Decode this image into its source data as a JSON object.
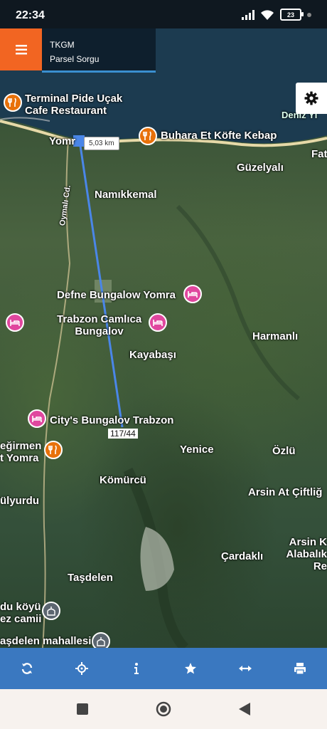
{
  "status": {
    "time": "22:34",
    "battery": "23"
  },
  "header": {
    "title": "TKGM",
    "subtitle": "Parsel Sorgu"
  },
  "map": {
    "measure_label": "5,03 km",
    "parcel_label": "117/44",
    "labels": {
      "terminal": "Terminal Pide Uçak\nCafe Restaurant",
      "buhara": "Buhara Et Köfte Kebap",
      "deniz": "Deniz Yı",
      "yomra": "Yomr",
      "guzelyali": "Güzelyalı",
      "fat": "Fat",
      "oymali": "Oymalı Cd.",
      "namikkemal": "Namıkkemal",
      "defne": "Defne Bungalow Yomra",
      "camlica": "Trabzon Camlıca\nBungalov",
      "harmanli": "Harmanlı",
      "kayabasi": "Kayabaşı",
      "citys": "City's Bungalov Trabzon",
      "degirmen": "eğirmen\nt Yomra",
      "yenice": "Yenice",
      "ozlu": "Özlü",
      "komurcu": "Kömürcü",
      "ulyurdu": "ülyurdu",
      "arsin_at": "Arsin At Çiftliğ",
      "arsin_alabalik": "Arsin K\nAlabalık Re",
      "cardakli": "Çardaklı",
      "tasdelen": "Taşdelen",
      "dukoyu": "du köyü\nez camii",
      "tasdelen_mah": "aşdelen mahallesi"
    }
  },
  "toolbar": {
    "items": [
      "refresh-icon",
      "locate-icon",
      "info-icon",
      "star-icon",
      "measure-icon",
      "print-icon"
    ]
  },
  "colors": {
    "accent": "#f26522",
    "toolbar": "#3a78c0",
    "measure_line": "#4a86e8"
  }
}
